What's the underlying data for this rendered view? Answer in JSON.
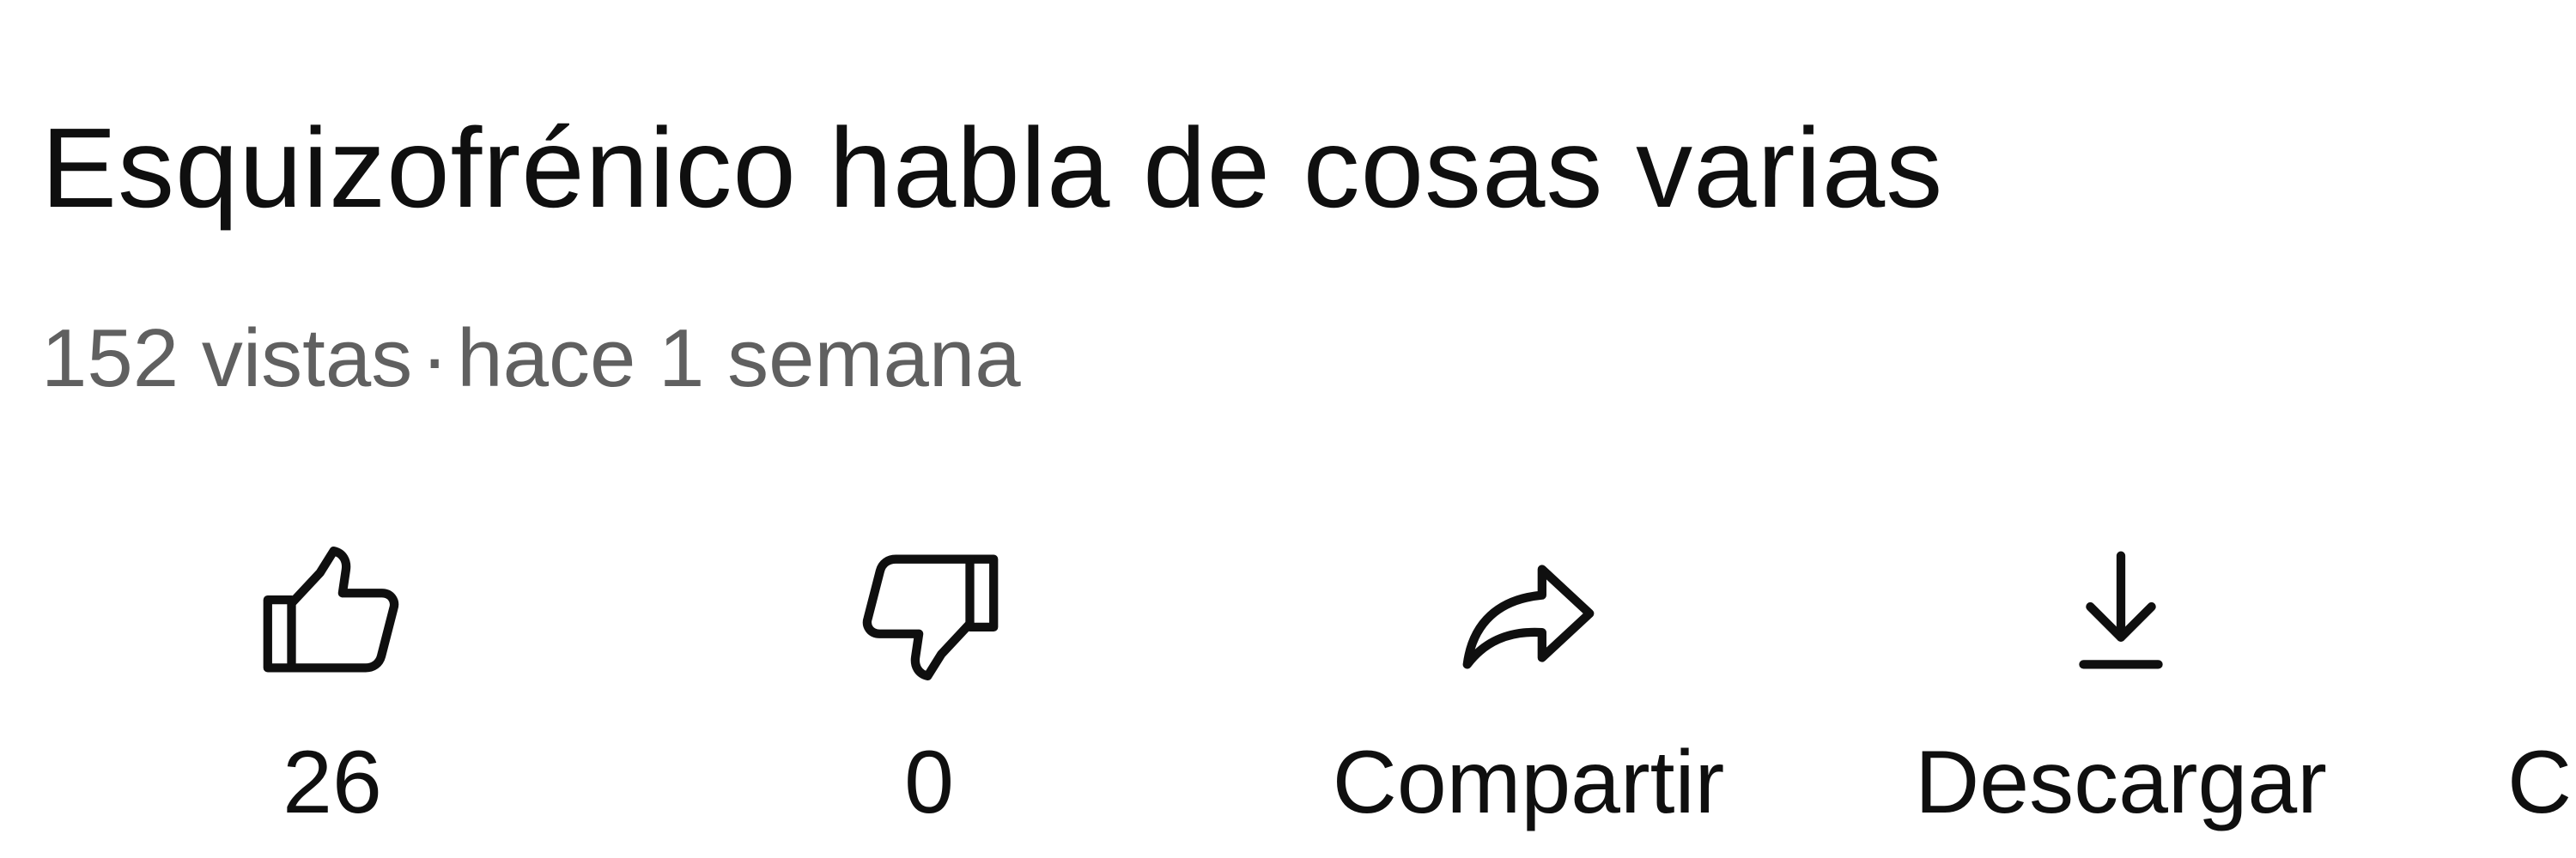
{
  "video": {
    "title": "Esquizofrénico habla de cosas varias",
    "views": "152 vistas",
    "separator": "·",
    "published": "hace 1 semana"
  },
  "actions": {
    "like": {
      "count": "26",
      "icon": "thumbs-up-icon"
    },
    "dislike": {
      "count": "0",
      "icon": "thumbs-down-icon"
    },
    "share": {
      "label": "Compartir",
      "icon": "share-arrow-icon"
    },
    "download": {
      "label": "Descargar",
      "icon": "download-icon"
    },
    "more": {
      "label": "C"
    }
  },
  "colors": {
    "primary_text": "#0f0f0f",
    "secondary_text": "#606060",
    "background": "#ffffff"
  }
}
